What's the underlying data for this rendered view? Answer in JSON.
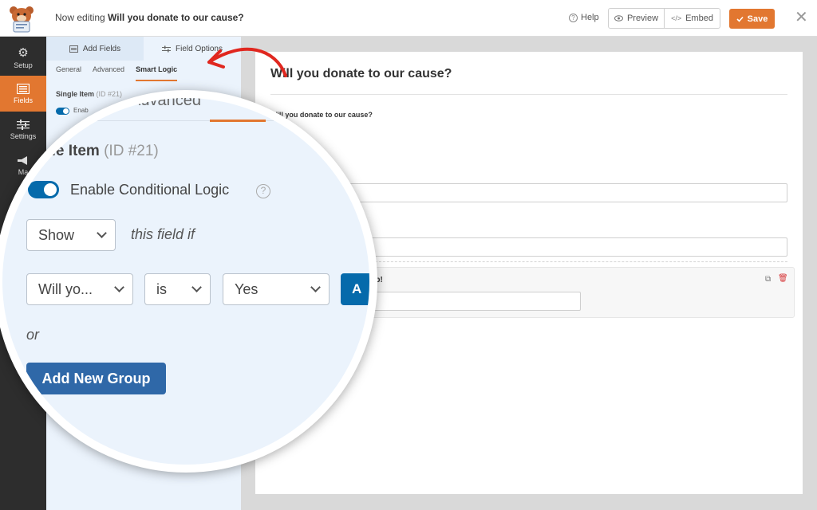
{
  "topbar": {
    "editing_prefix": "Now editing",
    "form_name": "Will you donate to our cause?",
    "help_label": "Help",
    "preview_label": "Preview",
    "embed_label": "Embed",
    "save_label": "Save",
    "close_glyph": "✕"
  },
  "colors": {
    "accent_orange": "#e27730",
    "toggle_blue": "#056aab",
    "button_blue": "#2f68a8",
    "nav_dark": "#2d2d2d",
    "panel_blue": "#ebf3fc",
    "delete_red": "#d63638",
    "arrow_red": "#e0271f"
  },
  "nav": {
    "items": [
      {
        "label": "Setup",
        "icon": "gear-icon"
      },
      {
        "label": "Fields",
        "icon": "fields-icon"
      },
      {
        "label": "Settings",
        "icon": "sliders-icon"
      },
      {
        "label": "Ma",
        "icon": "megaphone-icon"
      }
    ]
  },
  "panel": {
    "tabs": [
      {
        "label": "Add Fields",
        "icon": "list-icon"
      },
      {
        "label": "Field Options",
        "icon": "sliders-icon"
      }
    ],
    "subtabs": [
      "General",
      "Advanced",
      "Smart Logic"
    ],
    "field_title": "Single Item",
    "field_id": "(ID #21)",
    "toggle_label_partial": "Enab"
  },
  "preview": {
    "form_title": "Will you donate to our cause?",
    "question_label": "Will you donate to our cause?",
    "help_label_partial": "elp!"
  },
  "magnifier": {
    "tab_advanced": "Advanced",
    "title_partial": "gle Item",
    "field_id": "(ID #21)",
    "enable_label": "Enable Conditional Logic",
    "enabled": true,
    "show_value": "Show",
    "this_field_if": "this field if",
    "rule_field_value": "Will yo...",
    "rule_operator_value": "is",
    "rule_value": "Yes",
    "and_button_partial": "A",
    "or_label": "or",
    "add_group_label": "Add New Group"
  }
}
